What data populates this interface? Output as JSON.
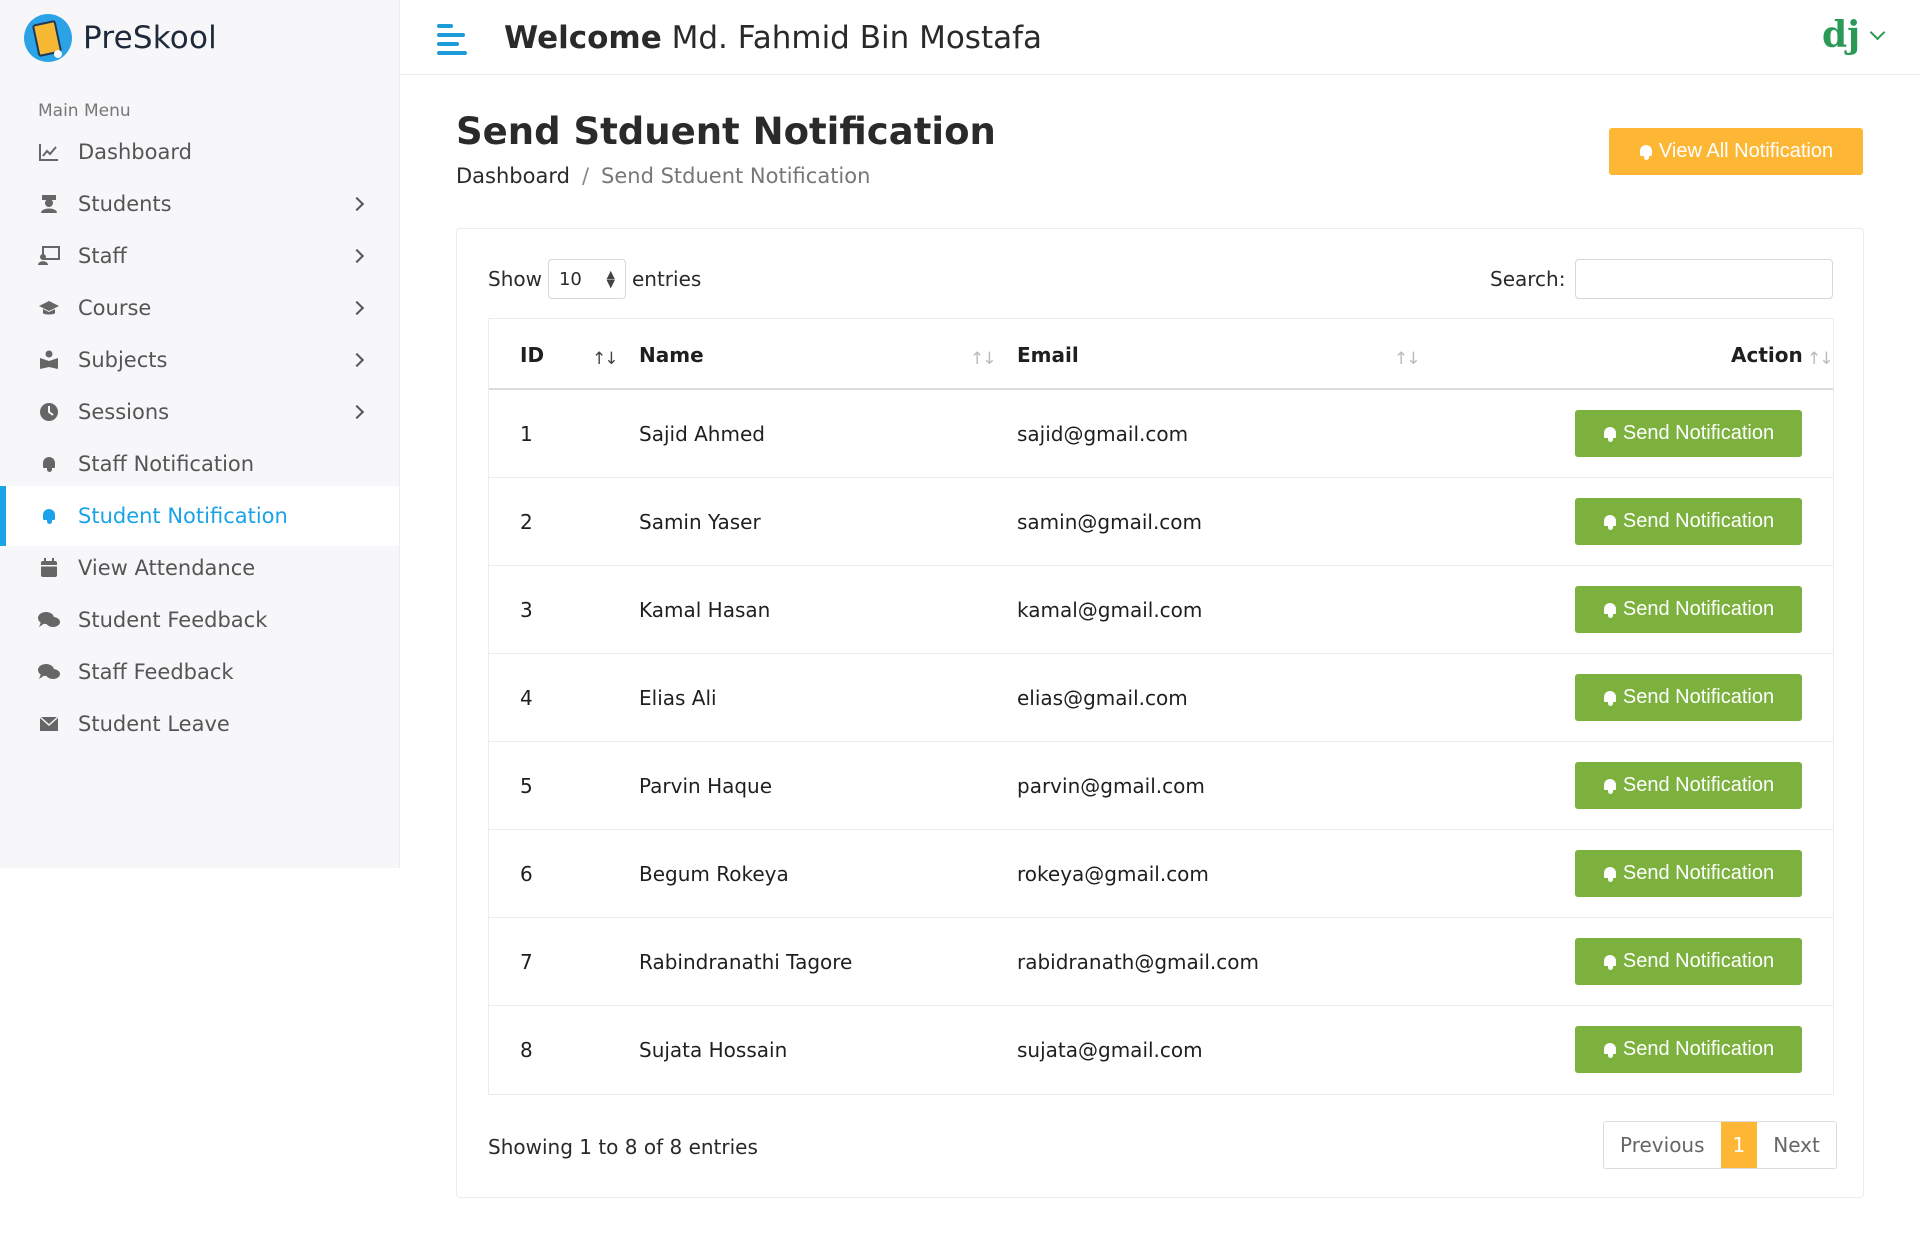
{
  "brand": {
    "name": "PreSkool"
  },
  "header": {
    "welcome_label": "Welcome",
    "user_name": "Md. Fahmid Bin Mostafa",
    "avatar_text": "dj"
  },
  "sidebar": {
    "menu_title": "Main Menu",
    "items": [
      {
        "label": "Dashboard",
        "icon": "chart-line-icon",
        "has_submenu": false
      },
      {
        "label": "Students",
        "icon": "graduate-icon",
        "has_submenu": true
      },
      {
        "label": "Staff",
        "icon": "teacher-icon",
        "has_submenu": true
      },
      {
        "label": "Course",
        "icon": "mortarboard-icon",
        "has_submenu": true
      },
      {
        "label": "Subjects",
        "icon": "book-reader-icon",
        "has_submenu": true
      },
      {
        "label": "Sessions",
        "icon": "clock-icon",
        "has_submenu": true
      },
      {
        "label": "Staff Notification",
        "icon": "bell-icon",
        "has_submenu": false
      },
      {
        "label": "Student Notification",
        "icon": "bell-icon",
        "has_submenu": false,
        "active": true
      },
      {
        "label": "View Attendance",
        "icon": "calendar-icon",
        "has_submenu": false
      },
      {
        "label": "Student Feedback",
        "icon": "comments-icon",
        "has_submenu": false
      },
      {
        "label": "Staff Feedback",
        "icon": "comments-icon",
        "has_submenu": false
      },
      {
        "label": "Student Leave",
        "icon": "envelope-icon",
        "has_submenu": false
      }
    ]
  },
  "page": {
    "title": "Send Stduent Notification",
    "breadcrumb": {
      "home": "Dashboard",
      "separator": "/",
      "current": "Send Stduent Notification"
    },
    "view_all_button": "View All Notification"
  },
  "table_controls": {
    "show_label": "Show",
    "entries_value": "10",
    "entries_label": "entries",
    "search_label": "Search:",
    "search_value": ""
  },
  "table": {
    "columns": [
      "ID",
      "Name",
      "Email",
      "Action"
    ],
    "action_button_label": "Send Notification",
    "rows": [
      {
        "id": "1",
        "name": "Sajid Ahmed",
        "email": "sajid@gmail.com"
      },
      {
        "id": "2",
        "name": "Samin Yaser",
        "email": "samin@gmail.com"
      },
      {
        "id": "3",
        "name": "Kamal Hasan",
        "email": "kamal@gmail.com"
      },
      {
        "id": "4",
        "name": "Elias Ali",
        "email": "elias@gmail.com"
      },
      {
        "id": "5",
        "name": "Parvin Haque",
        "email": "parvin@gmail.com"
      },
      {
        "id": "6",
        "name": "Begum Rokeya",
        "email": "rokeya@gmail.com"
      },
      {
        "id": "7",
        "name": "Rabindranathi Tagore",
        "email": "rabidranath@gmail.com"
      },
      {
        "id": "8",
        "name": "Sujata Hossain",
        "email": "sujata@gmail.com"
      }
    ]
  },
  "footer": {
    "info": "Showing 1 to 8 of 8 entries",
    "pagination": {
      "previous": "Previous",
      "current_page": "1",
      "next": "Next"
    }
  },
  "colors": {
    "accent_blue": "#1aa3e8",
    "button_orange": "#fdb735",
    "button_green": "#7bb13c",
    "avatar_green": "#2b9a57"
  }
}
